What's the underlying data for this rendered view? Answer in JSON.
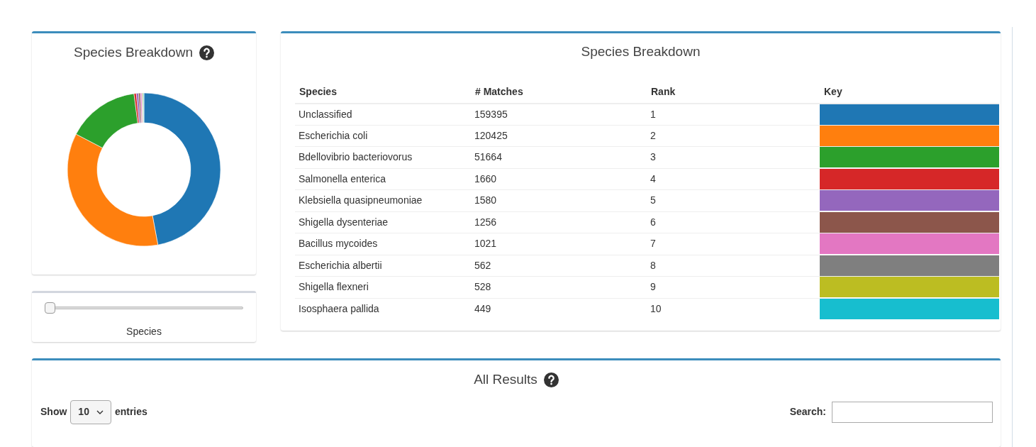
{
  "breakdown_panel": {
    "title": "Species Breakdown"
  },
  "slider": {
    "label": "Species",
    "level": 0
  },
  "species_table": {
    "title": "Species Breakdown",
    "columns": [
      "Species",
      "# Matches",
      "Rank",
      "Key"
    ],
    "rows": [
      {
        "species": "Unclassified",
        "matches": "159395",
        "rank": "1",
        "color": "#1f77b4"
      },
      {
        "species": "Escherichia coli",
        "matches": "120425",
        "rank": "2",
        "color": "#ff7f0e"
      },
      {
        "species": "Bdellovibrio bacteriovorus",
        "matches": "51664",
        "rank": "3",
        "color": "#2ca02c"
      },
      {
        "species": "Salmonella enterica",
        "matches": "1660",
        "rank": "4",
        "color": "#d62728"
      },
      {
        "species": "Klebsiella quasipneumoniae",
        "matches": "1580",
        "rank": "5",
        "color": "#9467bd"
      },
      {
        "species": "Shigella dysenteriae",
        "matches": "1256",
        "rank": "6",
        "color": "#8c564b"
      },
      {
        "species": "Bacillus mycoides",
        "matches": "1021",
        "rank": "7",
        "color": "#e377c2"
      },
      {
        "species": "Escherichia albertii",
        "matches": "562",
        "rank": "8",
        "color": "#7f7f7f"
      },
      {
        "species": "Shigella flexneri",
        "matches": "528",
        "rank": "9",
        "color": "#bcbd22"
      },
      {
        "species": "Isosphaera pallida",
        "matches": "449",
        "rank": "10",
        "color": "#17becf"
      }
    ]
  },
  "results": {
    "title": "All Results",
    "show_label": "Show",
    "entries_value": "10",
    "entries_label": "entries",
    "search_label": "Search:"
  }
}
